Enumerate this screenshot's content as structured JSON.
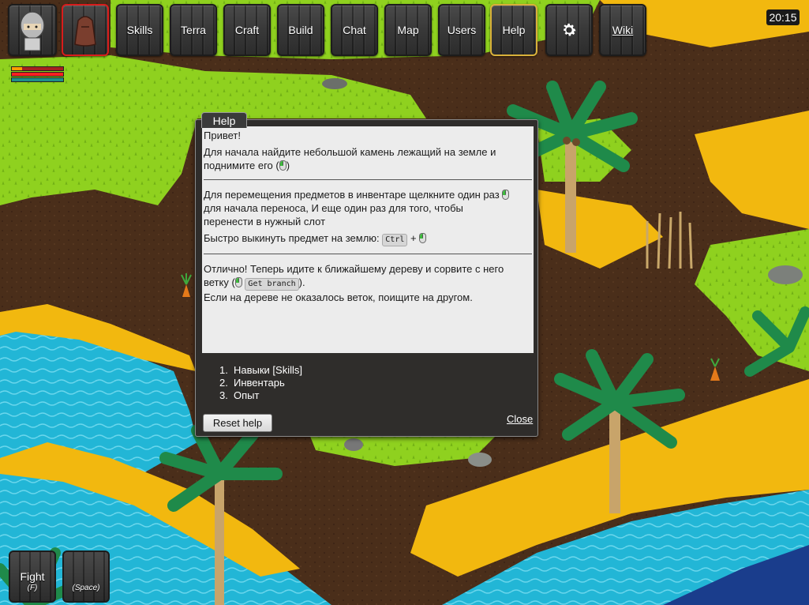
{
  "toolbar": {
    "skills": "Skills",
    "terra": "Terra",
    "craft": "Craft",
    "build": "Build",
    "chat": "Chat",
    "map": "Map",
    "users": "Users",
    "help": "Help",
    "settings_icon": "gear-icon",
    "wiki": "Wiki"
  },
  "status": {
    "bars": [
      "stamina",
      "health",
      "energy"
    ]
  },
  "clock": "20:15",
  "help": {
    "tab_title": "Help",
    "greeting": "Привет!",
    "intro_line1": "Для начала найдите небольшой камень лежащий на земле и",
    "intro_line2": "поднимите его (",
    "intro_line2_end": ")",
    "move_line1": "Для перемещения предметов в инвентаре щелкните один раз",
    "move_line2": "для начала переноса, И еще один раз для того, чтобы",
    "move_line3": "перенести в нужный слот",
    "drop_text": "Быстро выкинуть предмет на землю: ",
    "drop_key": "Ctrl",
    "drop_plus": " + ",
    "tree_line1": "Отлично! Теперь идите к ближайшему дереву и сорвите с него",
    "tree_line2_start": "ветку (",
    "tree_action": "Get branch",
    "tree_line2_end": ").",
    "tree_line3": "Если на дереве не оказалось веток, поищите на другом.",
    "steps": [
      {
        "num": "1.",
        "label": "Навыки [Skills]"
      },
      {
        "num": "2.",
        "label": "Инвентарь"
      },
      {
        "num": "3.",
        "label": "Опыт"
      }
    ],
    "reset_label": "Reset help",
    "close_label": "Close"
  },
  "actions": {
    "fight_label": "Fight",
    "fight_key": "(F)",
    "space_key": "(Space)"
  },
  "colors": {
    "grass": "#8fd11f",
    "sand": "#f2b80f",
    "soil": "#4a2e1a",
    "water": "#20b4d8",
    "deep_water": "#1a3d8c",
    "active_border": "#d9b13a",
    "bag_border": "#d81c1c"
  }
}
